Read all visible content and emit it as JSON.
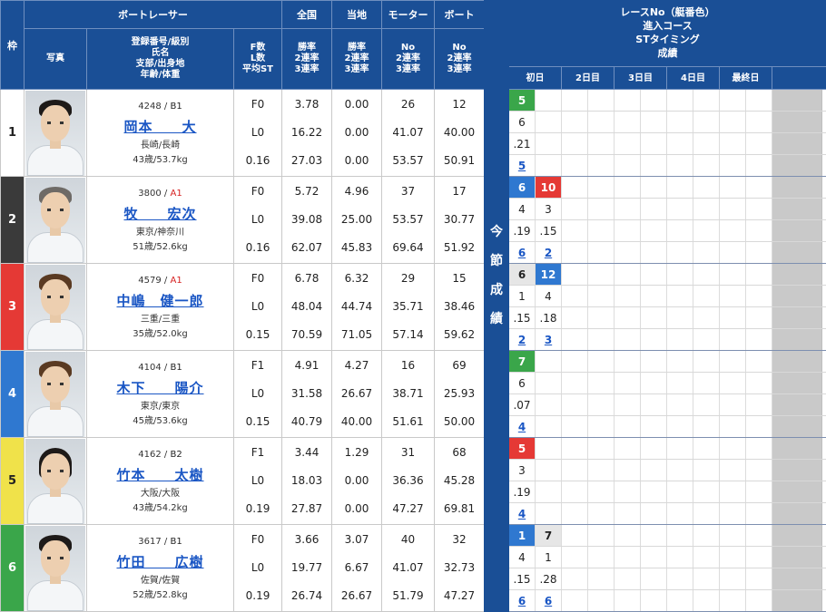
{
  "header": {
    "frame": "枠",
    "boat_racer": "ボートレーサー",
    "zenkoku": "全国",
    "touchi": "当地",
    "motor": "モーター",
    "boat": "ボート",
    "photo": "写真",
    "racer_sub": [
      "登録番号/級別",
      "氏名",
      "支部/出身地",
      "年齢/体重"
    ],
    "fl_sub": [
      "F数",
      "L数",
      "平均ST"
    ],
    "rate_sub": [
      "勝率",
      "2連率",
      "3連率"
    ],
    "motor_sub": [
      "No",
      "2連率",
      "3連率"
    ],
    "boat_sub": [
      "No",
      "2連率",
      "3連率"
    ]
  },
  "racers": [
    {
      "frame": "1",
      "color": "#ffffff",
      "text": "#222222",
      "id": "4248",
      "cls": "B1",
      "name": "岡本　　大",
      "home": "長崎/長崎",
      "age": "43歳/53.7kg",
      "fl": [
        "F0",
        "L0",
        "0.16"
      ],
      "zen": [
        "3.78",
        "16.22",
        "27.03"
      ],
      "tou": [
        "0.00",
        "0.00",
        "0.00"
      ],
      "mot": [
        "26",
        "41.07",
        "53.57"
      ],
      "boa": [
        "12",
        "40.00",
        "50.91"
      ]
    },
    {
      "frame": "2",
      "color": "#3a3a3a",
      "text": "#ffffff",
      "id": "3800",
      "cls": "A1",
      "name": "牧　　宏次",
      "home": "東京/神奈川",
      "age": "51歳/52.6kg",
      "fl": [
        "F0",
        "L0",
        "0.16"
      ],
      "zen": [
        "5.72",
        "39.08",
        "62.07"
      ],
      "tou": [
        "4.96",
        "25.00",
        "45.83"
      ],
      "mot": [
        "37",
        "53.57",
        "69.64"
      ],
      "boa": [
        "17",
        "30.77",
        "51.92"
      ]
    },
    {
      "frame": "3",
      "color": "#e53935",
      "text": "#ffffff",
      "id": "4579",
      "cls": "A1",
      "name": "中嶋　健一郎",
      "home": "三重/三重",
      "age": "35歳/52.0kg",
      "fl": [
        "F0",
        "L0",
        "0.15"
      ],
      "zen": [
        "6.78",
        "48.04",
        "70.59"
      ],
      "tou": [
        "6.32",
        "44.74",
        "71.05"
      ],
      "mot": [
        "29",
        "35.71",
        "57.14"
      ],
      "boa": [
        "15",
        "38.46",
        "59.62"
      ]
    },
    {
      "frame": "4",
      "color": "#2f78d0",
      "text": "#ffffff",
      "id": "4104",
      "cls": "B1",
      "name": "木下　　陽介",
      "home": "東京/東京",
      "age": "45歳/53.6kg",
      "fl": [
        "F1",
        "L0",
        "0.15"
      ],
      "zen": [
        "4.91",
        "31.58",
        "40.79"
      ],
      "tou": [
        "4.27",
        "26.67",
        "40.00"
      ],
      "mot": [
        "16",
        "38.71",
        "51.61"
      ],
      "boa": [
        "69",
        "25.93",
        "50.00"
      ]
    },
    {
      "frame": "5",
      "color": "#f0e24a",
      "text": "#222222",
      "id": "4162",
      "cls": "B2",
      "name": "竹本　　太樹",
      "home": "大阪/大阪",
      "age": "43歳/54.2kg",
      "fl": [
        "F1",
        "L0",
        "0.19"
      ],
      "zen": [
        "3.44",
        "18.03",
        "27.87"
      ],
      "tou": [
        "1.29",
        "0.00",
        "0.00"
      ],
      "mot": [
        "31",
        "36.36",
        "47.27"
      ],
      "boa": [
        "68",
        "45.28",
        "69.81"
      ]
    },
    {
      "frame": "6",
      "color": "#3aa64a",
      "text": "#ffffff",
      "id": "3617",
      "cls": "B1",
      "name": "竹田　　広樹",
      "home": "佐賀/佐賀",
      "age": "52歳/52.8kg",
      "fl": [
        "F0",
        "L0",
        "0.19"
      ],
      "zen": [
        "3.66",
        "19.77",
        "26.74"
      ],
      "tou": [
        "3.07",
        "6.67",
        "26.67"
      ],
      "mot": [
        "40",
        "41.07",
        "51.79"
      ],
      "boa": [
        "32",
        "32.73",
        "47.27"
      ]
    }
  ],
  "band_text": [
    "今",
    "節",
    "成",
    "績"
  ],
  "right": {
    "title_lines": [
      "レースNo（艇番色）",
      "進入コース",
      "STタイミング",
      "成績"
    ],
    "days": [
      "初日",
      "2日目",
      "3日目",
      "4日目",
      "最終日"
    ],
    "results": [
      [
        [
          "5",
          "6",
          ".21",
          "5"
        ],
        null
      ],
      [
        [
          "6",
          "4",
          ".19",
          "6"
        ],
        [
          "10",
          "3",
          ".15",
          "2"
        ]
      ],
      [
        [
          "6",
          "1",
          ".15",
          "2"
        ],
        [
          "12",
          "4",
          ".18",
          "3"
        ]
      ],
      [
        [
          "7",
          "6",
          ".07",
          "4"
        ],
        null
      ],
      [
        [
          "5",
          "3",
          ".19",
          "4"
        ],
        null
      ],
      [
        [
          "1",
          "4",
          ".15",
          "6"
        ],
        [
          "7",
          "1",
          ".28",
          "6"
        ]
      ]
    ],
    "badge_colors": [
      [
        "#3aa64a",
        null
      ],
      [
        "#2f78d0",
        "#e53935"
      ],
      [
        "#e6e6e6",
        "#2f78d0"
      ],
      [
        "#3aa64a",
        null
      ],
      [
        "#e53935",
        null
      ],
      [
        "#2f78d0",
        "#e6e6e6"
      ]
    ]
  }
}
